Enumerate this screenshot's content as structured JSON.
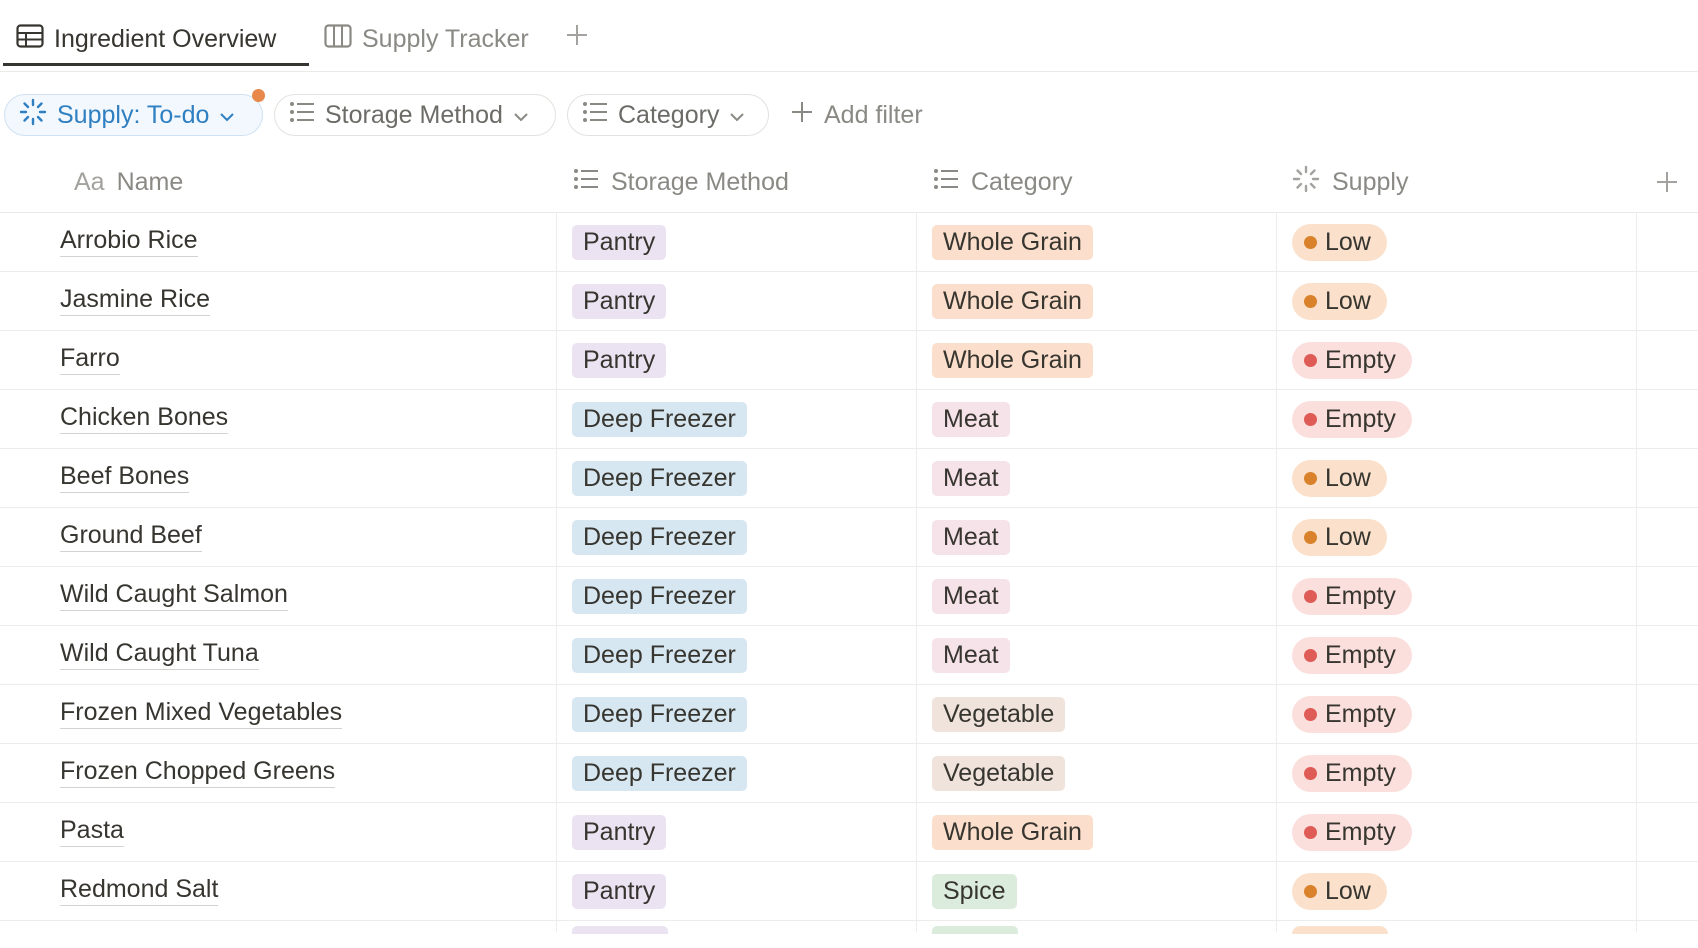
{
  "tabs": [
    {
      "label": "Ingredient Overview",
      "icon": "table-icon",
      "active": true
    },
    {
      "label": "Supply Tracker",
      "icon": "board-icon",
      "active": false
    }
  ],
  "filters": {
    "supply": {
      "label": "Supply: To-do",
      "icon": "status-icon",
      "color": "#2f7fc1"
    },
    "storage": {
      "label": "Storage Method",
      "icon": "list-icon"
    },
    "category": {
      "label": "Category",
      "icon": "list-icon"
    },
    "add": {
      "label": "Add filter",
      "icon": "plus-icon"
    }
  },
  "columns": [
    {
      "label": "Name",
      "icon": "text-icon",
      "icon_text": "Aa"
    },
    {
      "label": "Storage Method",
      "icon": "list-icon"
    },
    {
      "label": "Category",
      "icon": "list-icon"
    },
    {
      "label": "Supply",
      "icon": "status-icon"
    }
  ],
  "rows": [
    {
      "name": "Arrobio Rice",
      "storage": "Pantry",
      "category": "Whole Grain",
      "supply": "Low"
    },
    {
      "name": "Jasmine Rice",
      "storage": "Pantry",
      "category": "Whole Grain",
      "supply": "Low"
    },
    {
      "name": "Farro",
      "storage": "Pantry",
      "category": "Whole Grain",
      "supply": "Empty"
    },
    {
      "name": "Chicken Bones",
      "storage": "Deep Freezer",
      "category": "Meat",
      "supply": "Empty"
    },
    {
      "name": "Beef Bones",
      "storage": "Deep Freezer",
      "category": "Meat",
      "supply": "Low"
    },
    {
      "name": "Ground Beef",
      "storage": "Deep Freezer",
      "category": "Meat",
      "supply": "Low"
    },
    {
      "name": "Wild Caught Salmon",
      "storage": "Deep Freezer",
      "category": "Meat",
      "supply": "Empty"
    },
    {
      "name": "Wild Caught Tuna",
      "storage": "Deep Freezer",
      "category": "Meat",
      "supply": "Empty"
    },
    {
      "name": "Frozen Mixed Vegetables",
      "storage": "Deep Freezer",
      "category": "Vegetable",
      "supply": "Empty"
    },
    {
      "name": "Frozen Chopped Greens",
      "storage": "Deep Freezer",
      "category": "Vegetable",
      "supply": "Empty"
    },
    {
      "name": "Pasta",
      "storage": "Pantry",
      "category": "Whole Grain",
      "supply": "Empty"
    },
    {
      "name": "Redmond Salt",
      "storage": "Pantry",
      "category": "Spice",
      "supply": "Low"
    }
  ],
  "tag_colors": {
    "Pantry": "#ece3f2",
    "Deep Freezer": "#d7e7f1",
    "Whole Grain": "#fbdecb",
    "Meat": "#f6e3ea",
    "Vegetable": "#efe3dc",
    "Spice": "#dcecdc",
    "Low": "#fbe1cc",
    "Empty": "#fbdfdd"
  }
}
